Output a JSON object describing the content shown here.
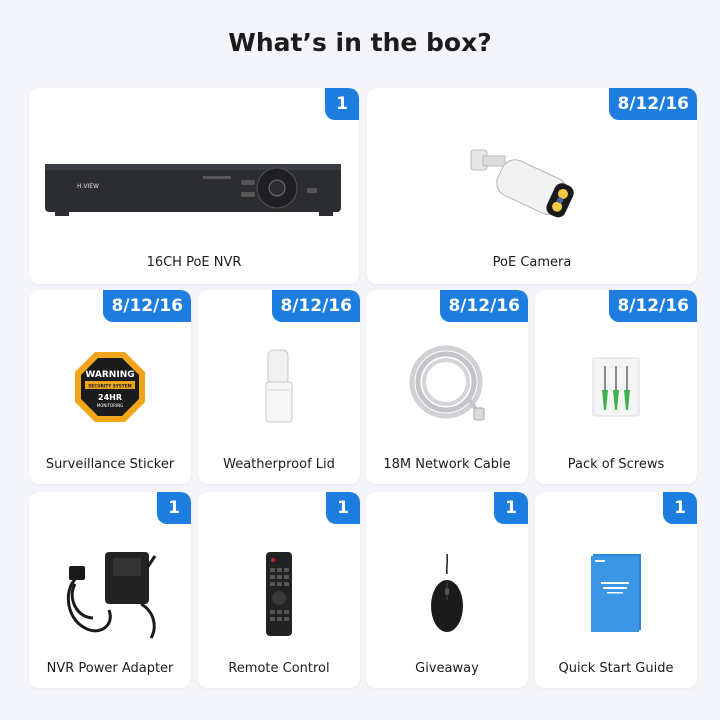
{
  "title": "What’s in the box?",
  "items": [
    {
      "badge": "1",
      "label": "16CH PoE NVR",
      "icon": "nvr-device"
    },
    {
      "badge": "8/12/16",
      "label": "PoE Camera",
      "icon": "bullet-camera"
    },
    {
      "badge": "8/12/16",
      "label": "Surveillance Sticker",
      "icon": "warning-sticker"
    },
    {
      "badge": "8/12/16",
      "label": "Weatherproof Lid",
      "icon": "weatherproof-lid"
    },
    {
      "badge": "8/12/16",
      "label": "18M Network Cable",
      "icon": "network-cable"
    },
    {
      "badge": "8/12/16",
      "label": "Pack of Screws",
      "icon": "screws-pack"
    },
    {
      "badge": "1",
      "label": "NVR Power Adapter",
      "icon": "power-adapter"
    },
    {
      "badge": "1",
      "label": "Remote Control",
      "icon": "remote-control"
    },
    {
      "badge": "1",
      "label": "Giveaway",
      "icon": "mouse"
    },
    {
      "badge": "1",
      "label": "Quick Start Guide",
      "icon": "guide-booklet"
    }
  ],
  "nvr": {
    "brand": "H.VIEW"
  },
  "sticker": {
    "line1": "WARNING",
    "line2": "SECURITY SYSTEM",
    "line3": "24HR",
    "line4": "MONITORING"
  },
  "colors": {
    "accent": "#1d7ee0",
    "background": "#f4f5fa",
    "card": "#ffffff"
  }
}
